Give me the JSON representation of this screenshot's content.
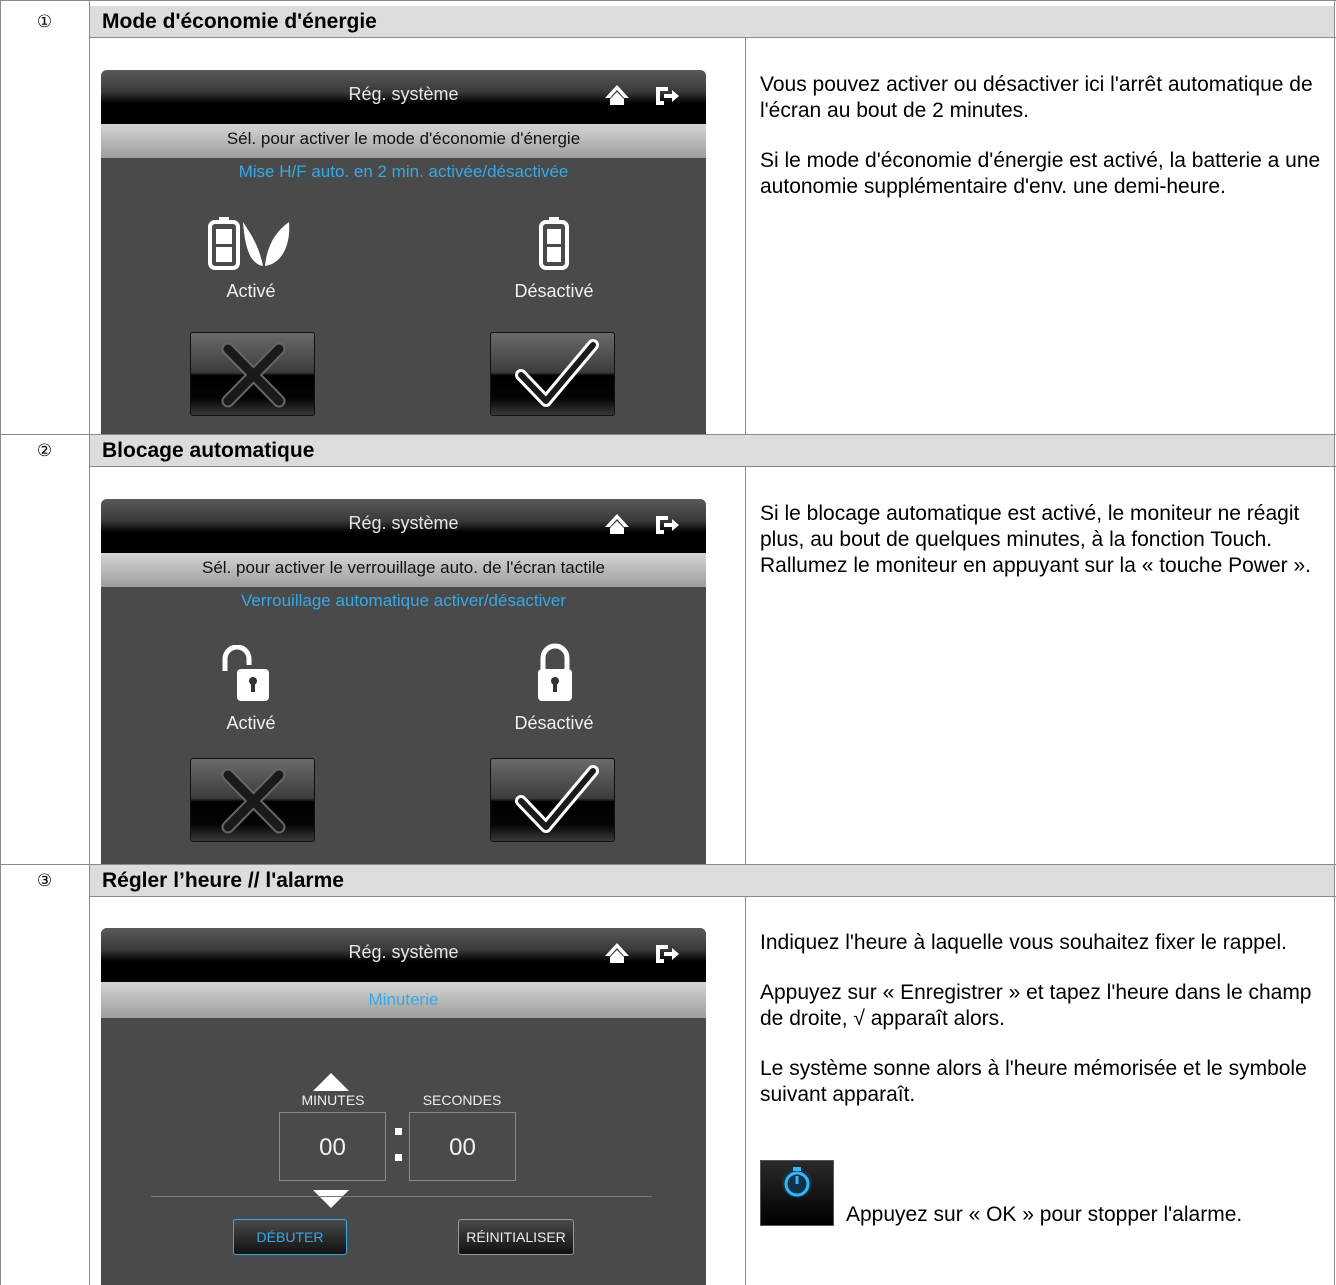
{
  "sections": [
    {
      "number": "①",
      "title": "Mode d'économie d'énergie",
      "screen": {
        "title": "Rég. système",
        "line1": "Sél. pour activer le mode d'économie d'énergie",
        "line2": "Mise H/F auto. en 2 min. activée/désactivée",
        "option_left": "Activé",
        "option_right": "Désactivé"
      },
      "description": [
        "Vous pouvez activer ou désactiver ici l'arrêt automatique de l'écran au bout de 2 minutes.",
        "Si le mode d'économie d'énergie est activé, la batterie a une autonomie supplémentaire d'env. une demi-heure."
      ]
    },
    {
      "number": "②",
      "title": "Blocage automatique",
      "screen": {
        "title": "Rég. système",
        "line1": "Sél. pour activer le verrouillage auto. de l'écran tactile",
        "line2": "Verrouillage automatique activer/désactiver",
        "option_left": "Activé",
        "option_right": "Désactivé"
      },
      "description": [
        "Si le blocage automatique est activé, le moniteur ne réagit plus, au bout de quelques minutes, à la fonction Touch. Rallumez le moniteur en appuyant sur la « touche Power »."
      ]
    },
    {
      "number": "③",
      "title": "Régler l’heure // l'alarme",
      "screen": {
        "title": "Rég. système",
        "line2": "Minuterie",
        "minutes_label": "MINUTES",
        "seconds_label": "SECONDES",
        "minutes_value": "00",
        "seconds_value": "00",
        "start_button": "DÉBUTER",
        "reset_button": "RÉINITIALISER"
      },
      "description": [
        "Indiquez l'heure à laquelle vous souhaitez fixer le rappel.",
        "Appuyez sur « Enregistrer » et tapez l'heure dans le champ de droite, √ apparaît alors.",
        "Le système sonne alors à l'heure mémorisée et le symbole suivant apparaît.",
        "Appuyez sur « OK » pour stopper l'alarme."
      ]
    }
  ],
  "colors": {
    "accent": "#35a9e6",
    "header_bg": "#dcdcdc",
    "screen_bg": "#4a4a4a"
  }
}
